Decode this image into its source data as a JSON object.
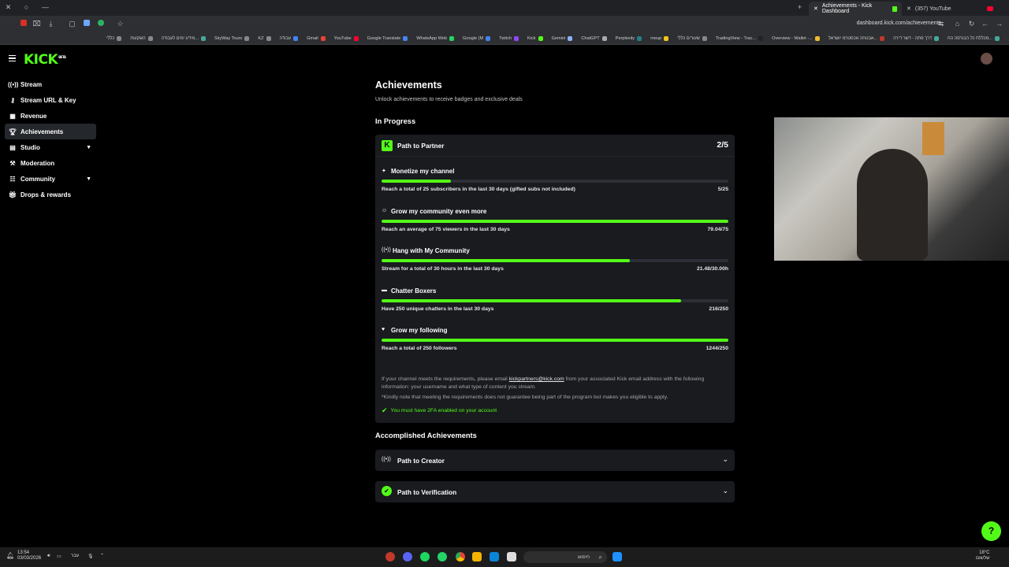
{
  "browser": {
    "tabs": [
      {
        "label": "Achievements - Kick Dashboard",
        "active": true
      },
      {
        "label": "(357) YouTube",
        "active": false
      }
    ],
    "url": "dashboard.kick.com/achievements",
    "bookmarks": [
      "כללי",
      "השקעות",
      "מידע ימים לעבודה...",
      "SkyWay Tours",
      "KZ",
      "עבודה",
      "Gmail",
      "YouTube",
      "Google Translate",
      "WhatsApp Web",
      "Google (M",
      "Twitch",
      "Kick",
      "Gemini",
      "ChatGPT",
      "Perplexity",
      "meup",
      "שעורים כללי",
      "TradingView - Trac...",
      "Overview - Wallet -...",
      "אבטחה אכסטרמ יושראל...",
      "דרך פתה - דשר דירה",
      "מכללת כל הבורסה הח..."
    ]
  },
  "app": {
    "brand": "KICK",
    "brand_badge": "BETA",
    "accent_color": "#53fc18"
  },
  "sidebar": {
    "items": [
      {
        "label": "Stream",
        "icon": "broadcast-icon"
      },
      {
        "label": "Stream URL & Key",
        "icon": "key-icon"
      },
      {
        "label": "Revenue",
        "icon": "chart-icon"
      },
      {
        "label": "Achievements",
        "icon": "trophy-icon",
        "active": true
      },
      {
        "label": "Studio",
        "icon": "studio-icon",
        "expandable": true
      },
      {
        "label": "Moderation",
        "icon": "hammer-icon"
      },
      {
        "label": "Community",
        "icon": "community-icon",
        "expandable": true
      },
      {
        "label": "Drops & rewards",
        "icon": "gift-icon"
      }
    ]
  },
  "page": {
    "title": "Achievements",
    "subtitle": "Unlock achievements to receive badges and exclusive deals",
    "in_progress_heading": "In Progress",
    "accomplished_heading": "Accomplished Achievements"
  },
  "partner": {
    "title": "Path to Partner",
    "count": "2/5",
    "achievements": [
      {
        "title": "Monetize my channel",
        "icon": "sparkle-icon",
        "desc": "Reach a total of 25 subscribers in the last 30 days (gifted subs not included)",
        "value": "5/25",
        "progress": 0.2
      },
      {
        "title": "Grow my community even more",
        "icon": "people-icon",
        "desc": "Reach an average of 75 viewers in the last 30 days",
        "value": "79.04/75",
        "progress": 1.0
      },
      {
        "title": "Hang with My Community",
        "icon": "broadcast-icon",
        "desc": "Stream for a total of 30 hours in the last 30 days",
        "value": "21.48/30.00h",
        "progress": 0.716
      },
      {
        "title": "Chatter Boxers",
        "icon": "chat-icon",
        "desc": "Have 250 unique chatters in the last 30 days",
        "value": "216/250",
        "progress": 0.864
      },
      {
        "title": "Grow my following",
        "icon": "heart-icon",
        "desc": "Reach a total of 250 followers",
        "value": "1244/250",
        "progress": 1.0
      }
    ],
    "note_before_link": "If your channel meets the requirements, please email",
    "note_link": "kickpartners@kick.com",
    "note_after_link": "from your associated Kick email address with the following information: your username and what type of content you stream.",
    "note2": "*Kindly note that meeting the requirements does not guarantee being part of the program but makes you eligible to apply.",
    "requirement": "You must have 2FA enabled on your account"
  },
  "accomplished": [
    {
      "title": "Path to Creator",
      "icon": "broadcast-icon"
    },
    {
      "title": "Path to Verification",
      "icon": "verified-badge-icon"
    }
  ],
  "taskbar": {
    "time": "13:54",
    "date": "03/03/2026",
    "lang": "עבר",
    "search_placeholder": "חיפוש",
    "weather": "18°C",
    "weather_label": "שלשום"
  }
}
